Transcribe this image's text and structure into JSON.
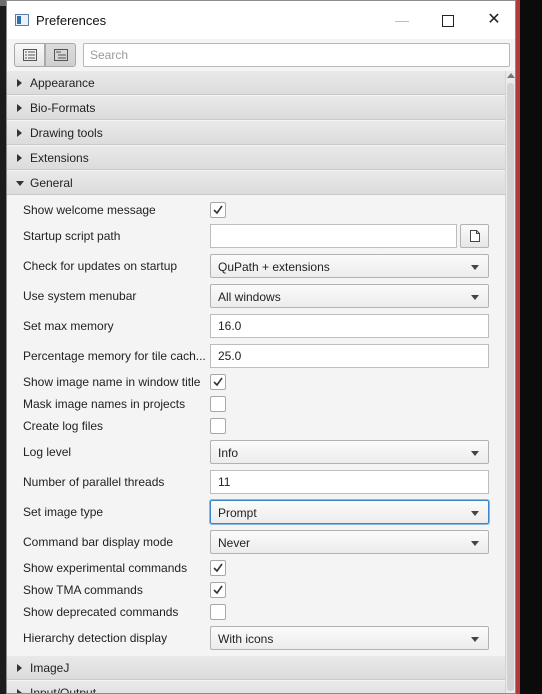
{
  "window": {
    "title": "Preferences"
  },
  "toolbar": {
    "search_placeholder": "Search"
  },
  "categories_top": [
    "Appearance",
    "Bio-Formats",
    "Drawing tools",
    "Extensions"
  ],
  "general": {
    "label": "General",
    "show_welcome_label": "Show welcome message",
    "show_welcome_checked": true,
    "startup_script_label": "Startup script path",
    "startup_script_value": "",
    "check_updates_label": "Check for updates on startup",
    "check_updates_value": "QuPath + extensions",
    "system_menubar_label": "Use system menubar",
    "system_menubar_value": "All windows",
    "max_memory_label": "Set max memory",
    "max_memory_value": "16.0",
    "tile_cache_label": "Percentage memory for tile cach...",
    "tile_cache_value": "25.0",
    "show_image_name_label": "Show image name in window title",
    "show_image_name_checked": true,
    "mask_names_label": "Mask image names in projects",
    "mask_names_checked": false,
    "log_files_label": "Create log files",
    "log_files_checked": false,
    "log_level_label": "Log level",
    "log_level_value": "Info",
    "threads_label": "Number of parallel threads",
    "threads_value": "11",
    "image_type_label": "Set image type",
    "image_type_value": "Prompt",
    "command_bar_label": "Command bar display mode",
    "command_bar_value": "Never",
    "experimental_label": "Show experimental commands",
    "experimental_checked": true,
    "tma_label": "Show TMA commands",
    "tma_checked": true,
    "deprecated_label": "Show deprecated commands",
    "deprecated_checked": false,
    "hierarchy_label": "Hierarchy detection display",
    "hierarchy_value": "With icons"
  },
  "categories_bottom": [
    "ImageJ",
    "Input/Output"
  ]
}
